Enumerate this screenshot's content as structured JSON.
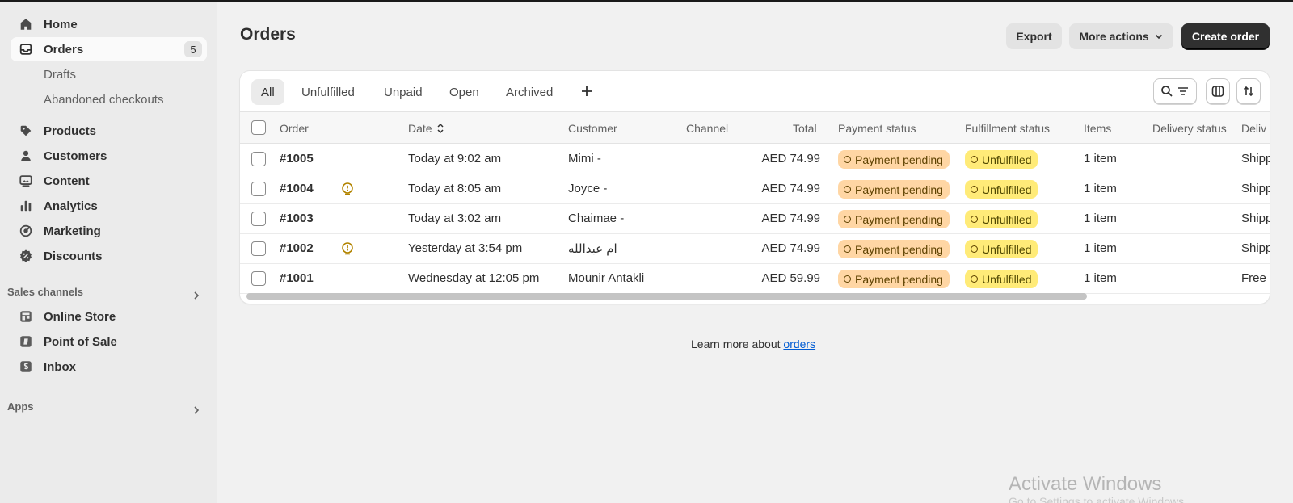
{
  "sidebar": {
    "home": "Home",
    "orders": "Orders",
    "orders_count": "5",
    "drafts": "Drafts",
    "abandoned": "Abandoned checkouts",
    "products": "Products",
    "customers": "Customers",
    "content": "Content",
    "analytics": "Analytics",
    "marketing": "Marketing",
    "discounts": "Discounts",
    "sales_channels_label": "Sales channels",
    "online_store": "Online Store",
    "point_of_sale": "Point of Sale",
    "inbox": "Inbox",
    "apps_label": "Apps"
  },
  "header": {
    "title": "Orders",
    "export": "Export",
    "more_actions": "More actions",
    "create_order": "Create order"
  },
  "tabs": [
    "All",
    "Unfulfilled",
    "Unpaid",
    "Open",
    "Archived"
  ],
  "table": {
    "columns": [
      "Order",
      "Date",
      "Customer",
      "Channel",
      "Total",
      "Payment status",
      "Fulfillment status",
      "Items",
      "Delivery status",
      "Deliv"
    ],
    "rows": [
      {
        "order": "#1005",
        "date": "Today at 9:02 am",
        "customer": "Mimi -",
        "total": "AED 74.99",
        "payment": "Payment pending",
        "fulfillment": "Unfulfilled",
        "items": "1 item",
        "delivery_method": "Shipp",
        "alert": false
      },
      {
        "order": "#1004",
        "date": "Today at 8:05 am",
        "customer": "Joyce -",
        "total": "AED 74.99",
        "payment": "Payment pending",
        "fulfillment": "Unfulfilled",
        "items": "1 item",
        "delivery_method": "Shipp",
        "alert": true
      },
      {
        "order": "#1003",
        "date": "Today at 3:02 am",
        "customer": "Chaimae -",
        "total": "AED 74.99",
        "payment": "Payment pending",
        "fulfillment": "Unfulfilled",
        "items": "1 item",
        "delivery_method": "Shipp",
        "alert": false
      },
      {
        "order": "#1002",
        "date": "Yesterday at 3:54 pm",
        "customer": "ام عبدالله",
        "total": "AED 74.99",
        "payment": "Payment pending",
        "fulfillment": "Unfulfilled",
        "items": "1 item",
        "delivery_method": "Shipp",
        "alert": true
      },
      {
        "order": "#1001",
        "date": "Wednesday at 12:05 pm",
        "customer": "Mounir Antakli",
        "total": "AED 59.99",
        "payment": "Payment pending",
        "fulfillment": "Unfulfilled",
        "items": "1 item",
        "delivery_method": "Free",
        "alert": false
      }
    ]
  },
  "footer": {
    "learn_prefix": "Learn more about ",
    "learn_link": "orders"
  },
  "watermark": {
    "line1": "Activate Windows",
    "line2": "Go to Settings to activate Windows."
  },
  "colors": {
    "payment_badge": "#ffd6a4",
    "fulfillment_badge": "#ffeb78",
    "primary_button": "#303030",
    "link": "#005bd3",
    "alert_icon": "#b28400"
  }
}
